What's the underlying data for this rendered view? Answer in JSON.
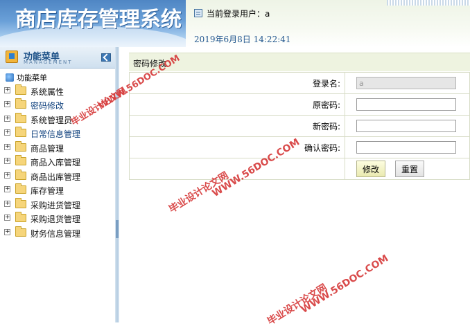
{
  "header": {
    "app_title": "商店库存管理系统",
    "current_user_label": "当前登录用户：a",
    "datetime": "2019年6月8日   14:22:41"
  },
  "sidebar": {
    "menu_title": "功能菜单",
    "menu_subtitle": "MANAGEMENT",
    "root_label": "功能菜单",
    "items": [
      {
        "label": "系统属性"
      },
      {
        "label": "密码修改"
      },
      {
        "label": "系统管理员"
      },
      {
        "label": "日常信息管理"
      },
      {
        "label": "商品管理"
      },
      {
        "label": "商品入库管理"
      },
      {
        "label": "商品出库管理"
      },
      {
        "label": "库存管理"
      },
      {
        "label": "采购进货管理"
      },
      {
        "label": "采购退货管理"
      },
      {
        "label": "财务信息管理"
      }
    ]
  },
  "main": {
    "panel_title": "密码修改",
    "form": {
      "login_name_label": "登录名:",
      "login_name_value": "a",
      "old_password_label": "原密码:",
      "new_password_label": "新密码:",
      "confirm_password_label": "确认密码:",
      "submit_label": "修改",
      "reset_label": "重置"
    }
  },
  "watermark": {
    "site_text": "毕业设计论文网",
    "url_text": "WWW.56DOC.COM",
    "color": "#d63b3b"
  }
}
